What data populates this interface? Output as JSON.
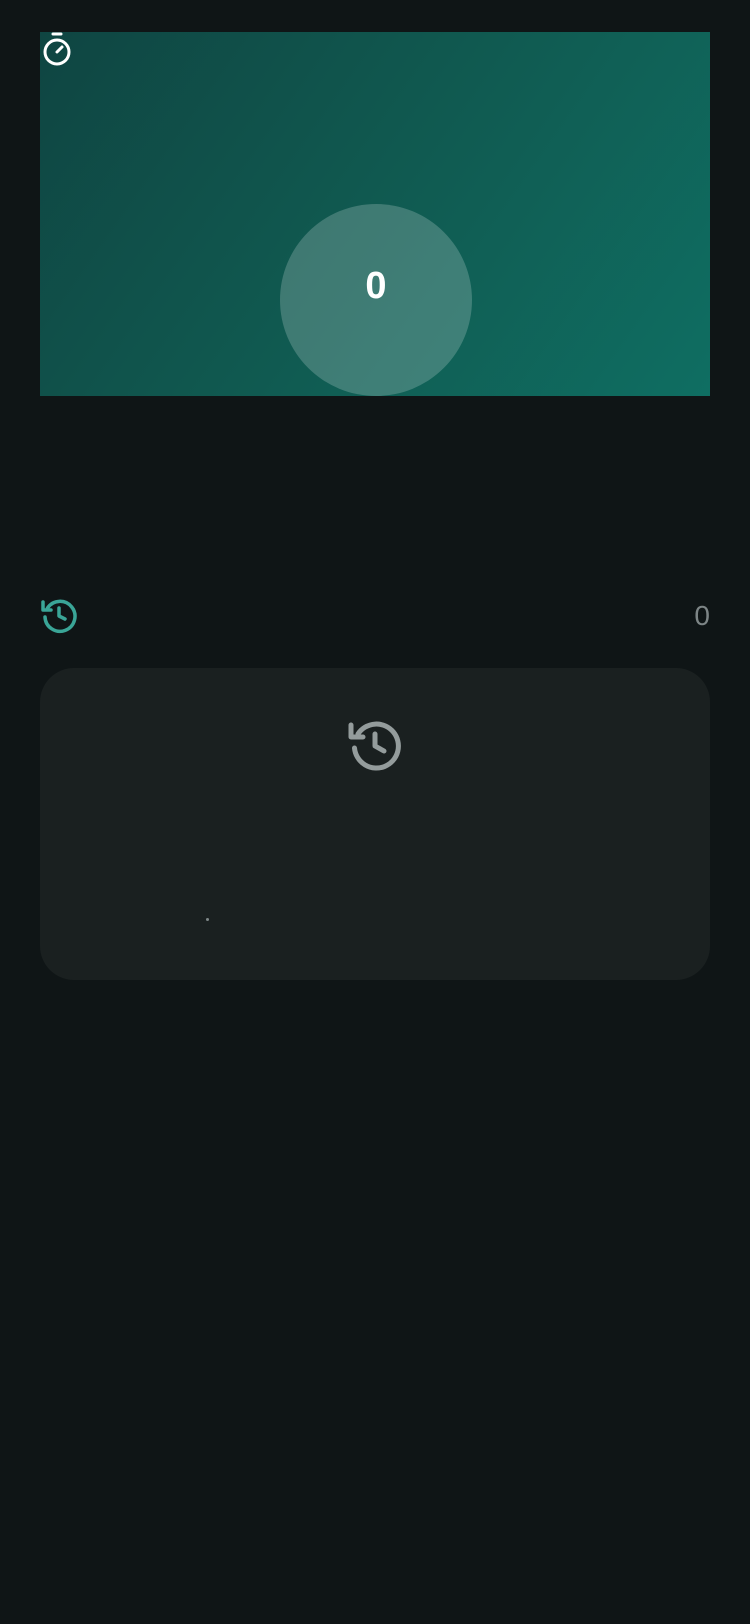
{
  "counter": {
    "value": "0"
  },
  "history": {
    "count": "0"
  },
  "icons": {
    "stopwatch": "stopwatch-icon",
    "history_header": "history-icon",
    "empty_history": "history-icon"
  },
  "colors": {
    "background": "#0f1516",
    "hero_gradient_start": "#0f4542",
    "hero_gradient_end": "#0f6e62",
    "accent": "#3aa597",
    "history_card": "#1a2020",
    "muted_text": "#7d8586"
  }
}
